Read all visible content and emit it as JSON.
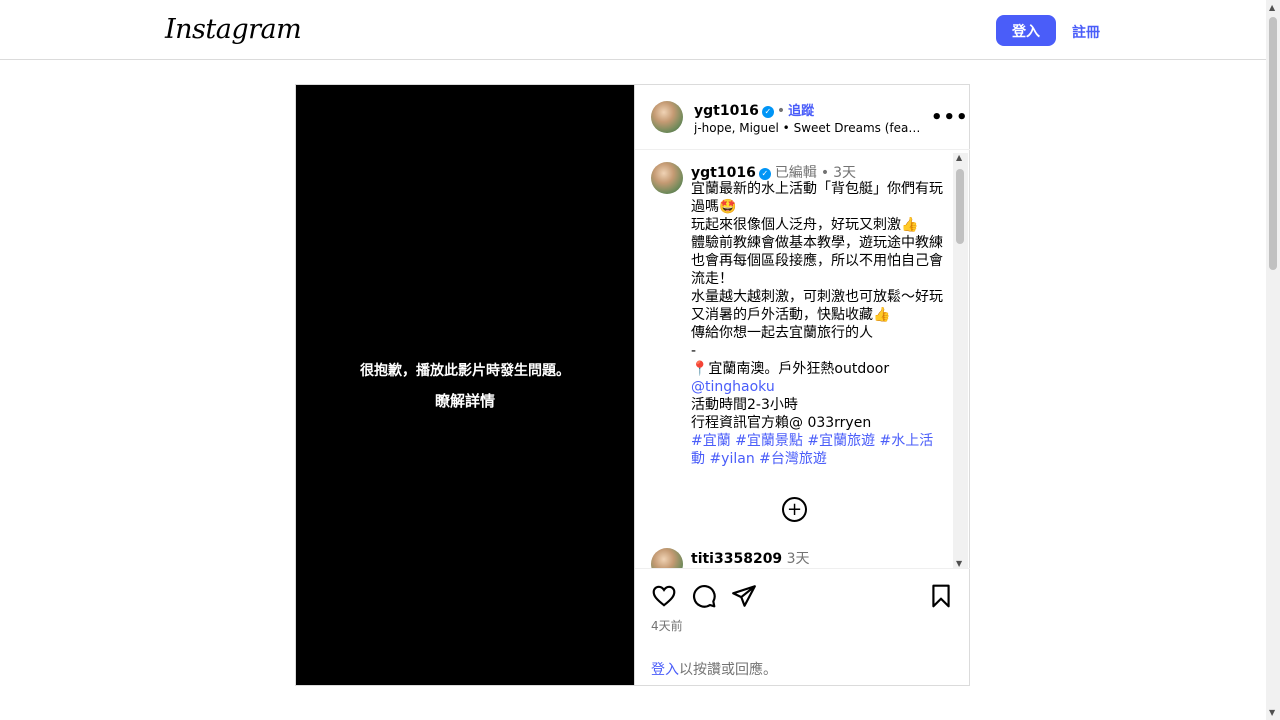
{
  "header": {
    "logo": "Instagram",
    "login_label": "登入",
    "signup_label": "註冊"
  },
  "video": {
    "error_text": "很抱歉，播放此影片時發生問題。",
    "learn_more": "瞭解詳情"
  },
  "post_header": {
    "username": "ygt1016",
    "separator": "•",
    "follow_label": "追蹤",
    "music": "j-hope, Miguel • Sweet Dreams (feat. Miguel)"
  },
  "caption": {
    "username": "ygt1016",
    "edited": "已編輯",
    "separator": "•",
    "time": "3天",
    "lines": [
      "宜蘭最新的水上活動「背包艇」你們有玩過嗎🤩",
      "玩起來很像個人泛舟，好玩又刺激👍",
      "體驗前教練會做基本教學，遊玩途中教練也會再每個區段接應，所以不用怕自己會流走！",
      "水量越大越刺激，可刺激也可放鬆～好玩又消暑的戶外活動，快點收藏👍",
      "傳給你想一起去宜蘭旅行的人",
      "-",
      "📍宜蘭南澳。戶外狂熱outdoor"
    ],
    "mention": "@tinghaoku",
    "lines2": [
      "活動時間2-3小時",
      "行程資訊官方賴@ 033rryen"
    ],
    "hashtags": "#宜蘭 #宜蘭景點 #宜蘭旅遊 #水上活動 #yilan #台灣旅遊"
  },
  "comment": {
    "username": "titi3358209",
    "time": "3天"
  },
  "footer": {
    "date": "4天前",
    "login_link": "登入",
    "login_rest": "以按讚或回應。"
  }
}
